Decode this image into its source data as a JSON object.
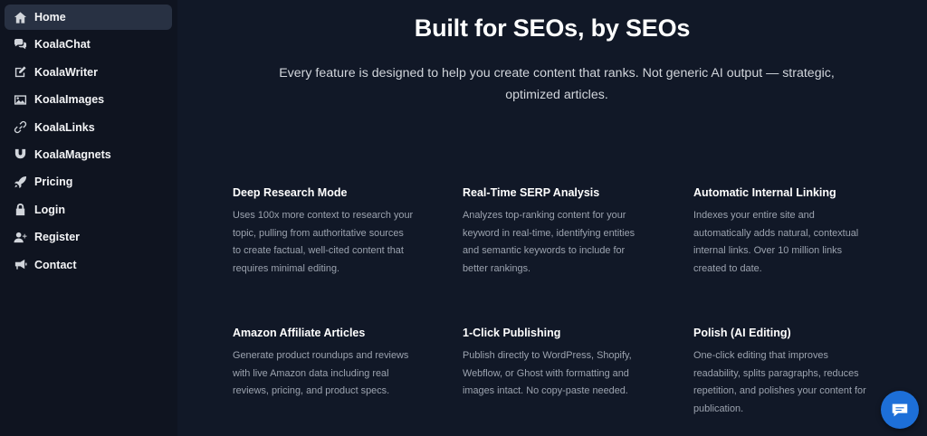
{
  "sidebar": {
    "items": [
      {
        "label": "Home",
        "icon": "home-icon",
        "active": true
      },
      {
        "label": "KoalaChat",
        "icon": "chat-icon"
      },
      {
        "label": "KoalaWriter",
        "icon": "edit-icon"
      },
      {
        "label": "KoalaImages",
        "icon": "image-icon"
      },
      {
        "label": "KoalaLinks",
        "icon": "link-icon"
      },
      {
        "label": "KoalaMagnets",
        "icon": "magnet-icon"
      },
      {
        "label": "Pricing",
        "icon": "rocket-icon"
      },
      {
        "label": "Login",
        "icon": "lock-icon"
      },
      {
        "label": "Register",
        "icon": "user-plus-icon"
      },
      {
        "label": "Contact",
        "icon": "megaphone-icon"
      }
    ]
  },
  "main": {
    "title": "Built for SEOs, by SEOs",
    "subtitle": "Every feature is designed to help you create content that ranks. Not generic AI output — strategic, optimized articles.",
    "features": [
      {
        "title": "Deep Research Mode",
        "text": "Uses 100x more context to research your topic, pulling from authoritative sources to create factual, well-cited content that requires minimal editing."
      },
      {
        "title": "Real-Time SERP Analysis",
        "text": "Analyzes top-ranking content for your keyword in real-time, identifying entities and semantic keywords to include for better rankings."
      },
      {
        "title": "Automatic Internal Linking",
        "text": "Indexes your entire site and automatically adds natural, contextual internal links. Over 10 million links created to date."
      },
      {
        "title": "Amazon Affiliate Articles",
        "text": "Generate product roundups and reviews with live Amazon data including real reviews, pricing, and product specs."
      },
      {
        "title": "1-Click Publishing",
        "text": "Publish directly to WordPress, Shopify, Webflow, or Ghost with formatting and images intact. No copy-paste needed."
      },
      {
        "title": "Polish (AI Editing)",
        "text": "One-click editing that improves readability, splits paragraphs, reduces repetition, and polishes your content for publication."
      }
    ]
  },
  "chat_widget": {
    "icon": "chat-bubble-icon",
    "color": "#1d6fd8"
  },
  "colors": {
    "background": "#111827",
    "sidebar_active": "#283143",
    "accent": "#1d6fd8"
  }
}
